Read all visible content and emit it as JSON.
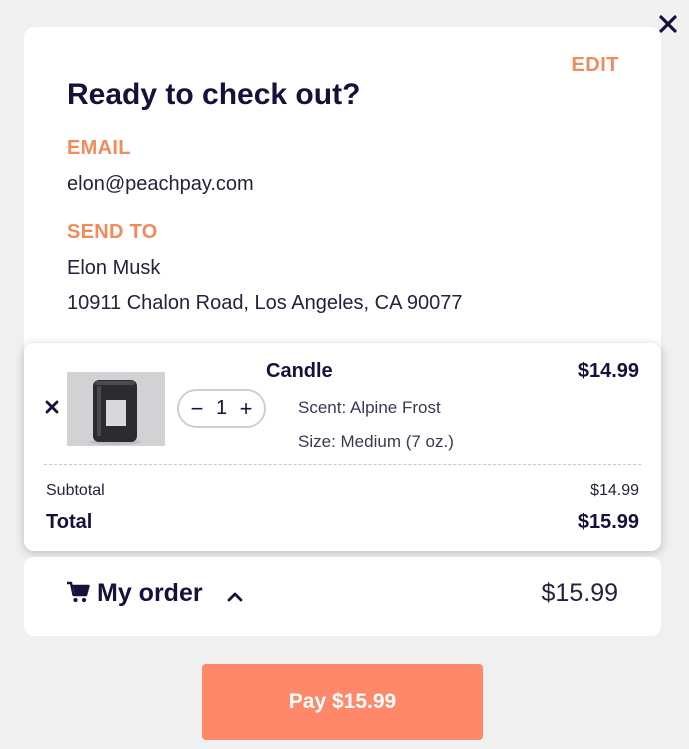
{
  "checkout": {
    "edit_label": "EDIT",
    "title": "Ready to check out?",
    "email_label": "EMAIL",
    "email_value": "elon@peachpay.com",
    "send_to_label": "SEND TO",
    "name": "Elon Musk",
    "address": "10911 Chalon Road, Los Angeles, CA 90077"
  },
  "cart": {
    "item": {
      "name": "Candle",
      "price": "$14.99",
      "quantity": "1",
      "scent": "Scent: Alpine Frost",
      "size": "Size: Medium (7 oz.)",
      "image": "candle-jar"
    },
    "decrement_symbol": "−",
    "increment_symbol": "+",
    "subtotal_label": "Subtotal",
    "subtotal_value": "$14.99",
    "total_label": "Total",
    "total_value": "$15.99"
  },
  "order_summary": {
    "label": "My order",
    "total": "$15.99",
    "icons": {
      "cart": "cart-icon",
      "toggle": "chevron-up-icon"
    }
  },
  "pay_button": {
    "label": "Pay $15.99"
  },
  "icons": {
    "close": "close-icon",
    "remove": "remove-item-icon"
  },
  "colors": {
    "accent": "#f28b5c",
    "pay_button": "#ff876a",
    "text_dark": "#14123a",
    "background": "#f0f0f1"
  }
}
